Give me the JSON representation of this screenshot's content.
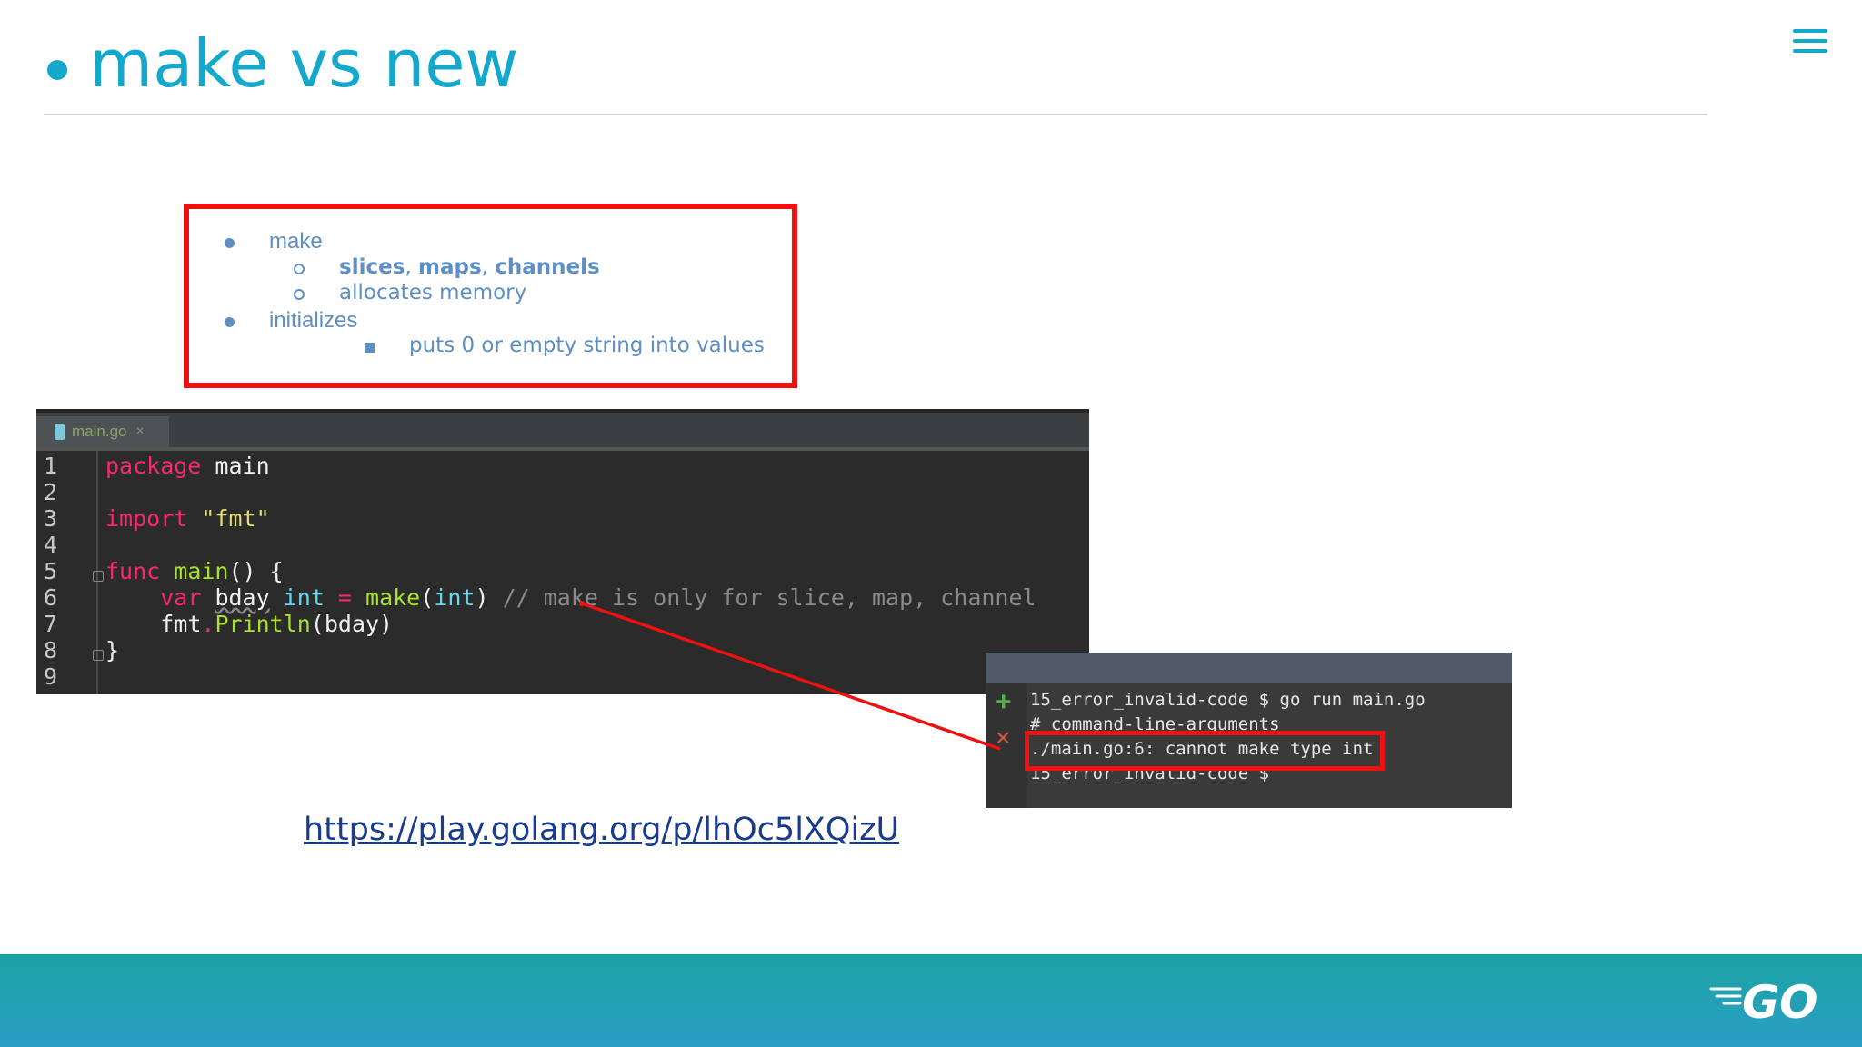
{
  "slide": {
    "title": "make vs new"
  },
  "notes": {
    "make_label": "make",
    "make_sub_1": {
      "slices": "slices",
      "sep1": ", ",
      "maps": "maps",
      "sep2": ", ",
      "channels": "channels"
    },
    "make_sub_2": "allocates memory",
    "initializes_label": "initializes",
    "initializes_sub": "puts 0 or empty string into values"
  },
  "editor": {
    "tab_label": "main.go",
    "tab_close": "×",
    "line_numbers": [
      "1",
      "2",
      "3",
      "4",
      "5",
      "6",
      "7",
      "8",
      "9"
    ],
    "line1": {
      "kw": "package",
      "rest": " main"
    },
    "line3": {
      "kw": "import",
      "sp": " ",
      "str": "\"fmt\""
    },
    "line5": {
      "kw": "func",
      "sp": " ",
      "fn": "main",
      "rest": "() {"
    },
    "line6": {
      "indent": "    ",
      "kw": "var",
      "sp1": " ",
      "ident": "bday",
      "sp2": " ",
      "ty": "int",
      "eq": " = ",
      "fn": "make",
      "open": "(",
      "ty2": "int",
      "close": ")",
      "comment": " // make is only for slice, map, channel"
    },
    "line7": {
      "indent": "    ",
      "pkg": "fmt",
      "dot": ".",
      "fn": "Println",
      "rest": "(bday)"
    },
    "line8": {
      "rest": "}"
    }
  },
  "terminal": {
    "plus_icon": "+",
    "close_icon": "×",
    "lines": [
      "15_error_invalid-code $ go run main.go",
      "# command-line-arguments",
      "./main.go:6: cannot make type int",
      "15_error_invalid-code $"
    ]
  },
  "link": {
    "text": "https://play.golang.org/p/lhOc5lXQizU"
  },
  "logo": {
    "text": "GO"
  }
}
